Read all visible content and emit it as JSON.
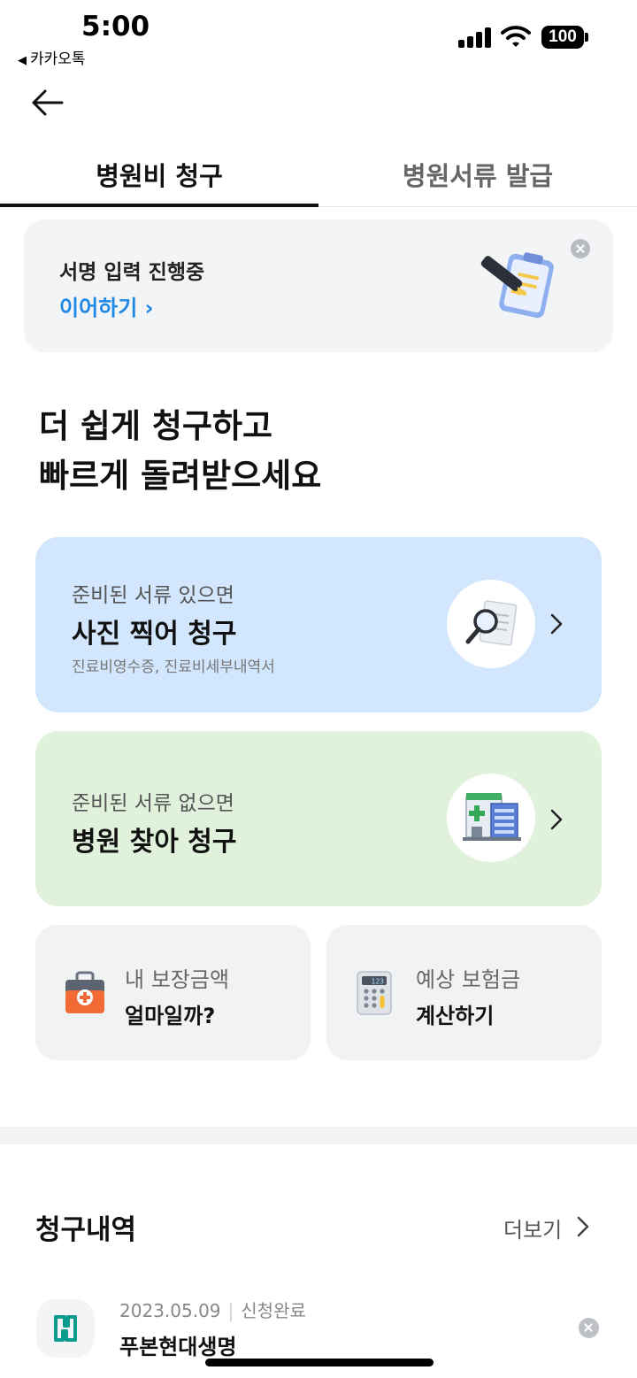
{
  "status_bar": {
    "time": "5:00",
    "back_app": "카카오톡",
    "battery": "100"
  },
  "tabs": [
    {
      "label": "병원비 청구",
      "active": true
    },
    {
      "label": "병원서류 발급",
      "active": false
    }
  ],
  "sign_banner": {
    "title": "서명 입력 진행중",
    "link": "이어하기 ›"
  },
  "headline": {
    "line1": "더 쉽게 청구하고",
    "line2": "빠르게 돌려받으세요"
  },
  "photo_claim": {
    "subtitle": "준비된 서류 있으면",
    "title": "사진 찍어 청구",
    "note": "진료비영수증, 진료비세부내역서"
  },
  "hospital_claim": {
    "subtitle": "준비된 서류 없으면",
    "title": "병원 찾아 청구"
  },
  "coverage_card": {
    "subtitle": "내 보장금액",
    "title": "얼마일까?"
  },
  "calculator_card": {
    "subtitle": "예상 보험금",
    "title": "계산하기",
    "display": "123"
  },
  "history": {
    "title": "청구내역",
    "more": "더보기",
    "items": [
      {
        "date": "2023.05.09",
        "status": "신청완료",
        "name": "푸본현대생명"
      }
    ]
  },
  "colors": {
    "link_blue": "#1e88e5",
    "card_blue": "#d2e7fd",
    "card_green": "#e0f2dc",
    "brand_teal": "#0a9a8e"
  }
}
